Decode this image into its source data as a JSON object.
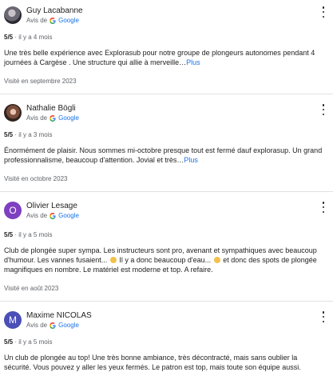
{
  "reviews": [
    {
      "author": "Guy Lacabanne",
      "source_prefix": "Avis de",
      "source": "Google",
      "rating": "5/5",
      "age": "il y a 4 mois",
      "text": "Une très belle expérience avec Explorasub pour notre groupe de plongeurs autonomes pendant 4 journées à Cargèse . Une structure qui allie à merveille…",
      "more_label": "Plus",
      "visited": "Visité en septembre 2023",
      "avatar_icon": "photo-avatar"
    },
    {
      "author": "Nathalie Bögli",
      "source_prefix": "Avis de",
      "source": "Google",
      "rating": "5/5",
      "age": "il y a 3 mois",
      "text": "Énormément de plaisir. Nous sommes mi-octobre presque tout est fermé dauf explorasup. Un grand professionnalisme, beaucoup d'attention. Jovial et très…",
      "more_label": "Plus",
      "visited": "Visité en octobre 2023",
      "avatar_icon": "photo-avatar"
    },
    {
      "author": "Olivier Lesage",
      "initial": "O",
      "source_prefix": "Avis de",
      "source": "Google",
      "rating": "5/5",
      "age": "il y a 5 mois",
      "text_1": "Club de plongée super sympa. Les instructeurs sont pro, avenant et sympathiques avec beaucoup d'humour. Les vannes fusaient...",
      "text_2": " Il y a donc beaucoup d'eau...",
      "text_3": " et donc des spots de plongée magnifiques en nombre. Le matériel est moderne et top. A refaire.",
      "visited": "Visité en août 2023",
      "avatar_color": "#7e3fc0"
    },
    {
      "author": "Maxime NICOLAS",
      "initial": "M",
      "source_prefix": "Avis de",
      "source": "Google",
      "rating": "5/5",
      "age": "il y a 5 mois",
      "text": "Un club de plongée au top! Une très bonne ambiance, très décontracté, mais sans oublier la sécurité. Vous pouvez y aller les yeux fermés. Le patron est top, mais toute son équipe aussi.",
      "avatar_color": "#4b4fb8"
    }
  ],
  "icons": {
    "menu": "more-vert-icon",
    "google": "google-g-icon",
    "emoji": "grinning-emoji-icon"
  }
}
